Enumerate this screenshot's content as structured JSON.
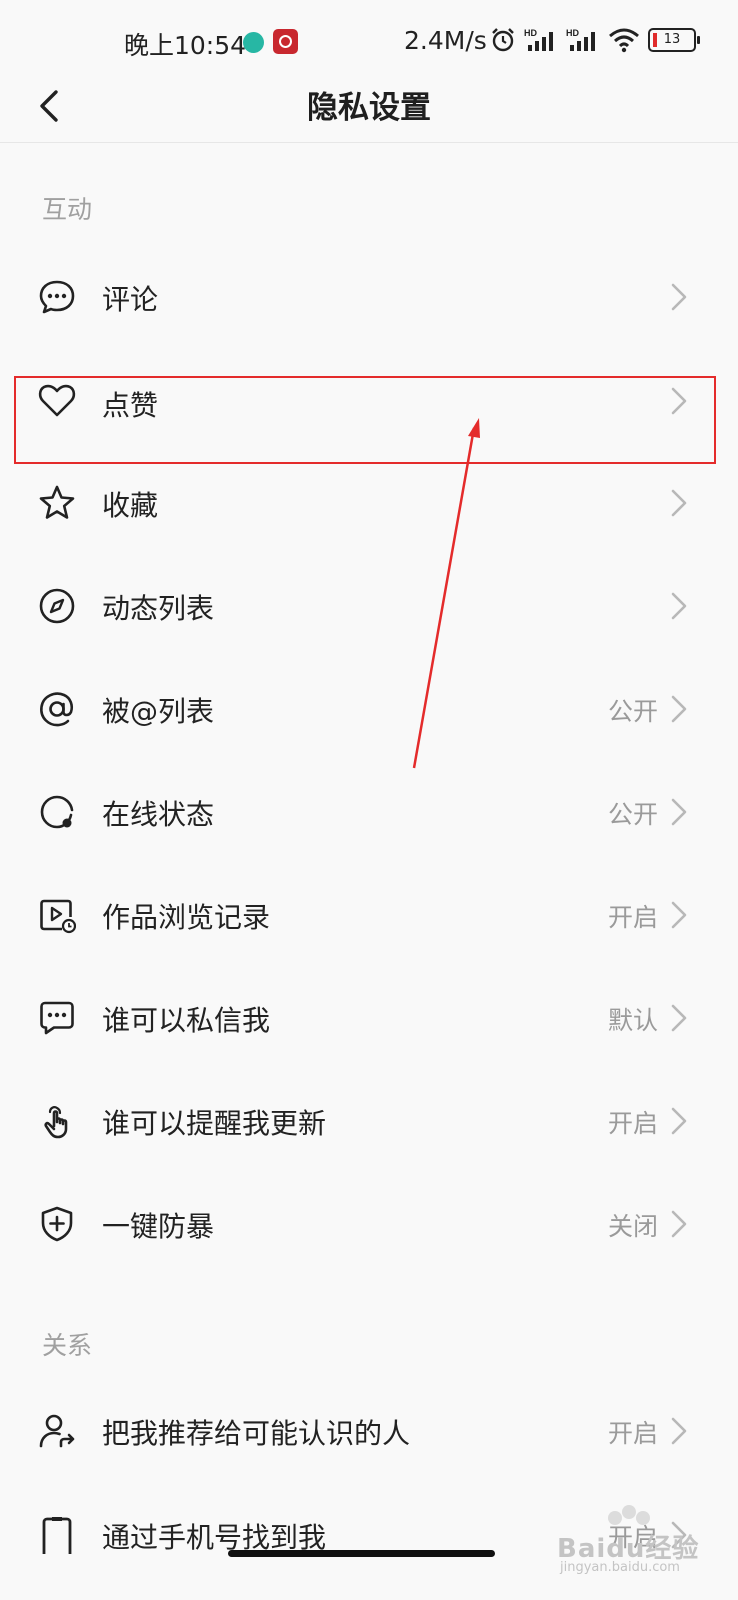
{
  "status_bar": {
    "time": "晚上10:54",
    "network_speed": "2.4M/s",
    "battery_level": "13",
    "icons": [
      "alarm-icon",
      "hd-signal-icon",
      "hd-signal-icon",
      "wifi-icon",
      "battery-icon"
    ]
  },
  "nav": {
    "title": "隐私设置",
    "back_icon": "chevron-left-icon"
  },
  "sections": {
    "interaction": {
      "header": "互动"
    },
    "relations": {
      "header": "关系"
    }
  },
  "rows": [
    {
      "label": "评论",
      "value": "",
      "icon": "comment-icon"
    },
    {
      "label": "点赞",
      "value": "",
      "icon": "heart-icon"
    },
    {
      "label": "收藏",
      "value": "",
      "icon": "star-icon"
    },
    {
      "label": "动态列表",
      "value": "",
      "icon": "compass-icon"
    },
    {
      "label": "被@列表",
      "value": "公开",
      "icon": "at-icon"
    },
    {
      "label": "在线状态",
      "value": "公开",
      "icon": "online-status-icon"
    },
    {
      "label": "作品浏览记录",
      "value": "开启",
      "icon": "video-history-icon"
    },
    {
      "label": "谁可以私信我",
      "value": "默认",
      "icon": "message-icon"
    },
    {
      "label": "谁可以提醒我更新",
      "value": "开启",
      "icon": "tap-hand-icon"
    },
    {
      "label": "一键防暴",
      "value": "关闭",
      "icon": "shield-plus-icon"
    },
    {
      "label": "把我推荐给可能认识的人",
      "value": "开启",
      "icon": "user-share-icon"
    },
    {
      "label": "通过手机号找到我",
      "value": "开启",
      "icon": "phone-icon"
    }
  ],
  "annotation": {
    "color": "#e42b2b"
  },
  "watermark": {
    "text": "Baidu经验",
    "sub": "jingyan.baidu.com"
  }
}
